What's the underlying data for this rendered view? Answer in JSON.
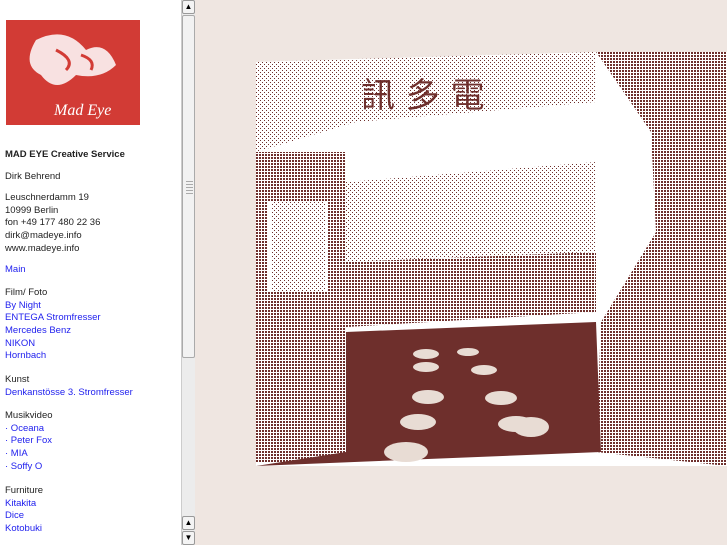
{
  "logo": {
    "text": "Mad Eye",
    "color": "#d23b35"
  },
  "sidebar": {
    "company": "MAD EYE Creative Service",
    "name": "Dirk Behrend",
    "address": [
      "Leuschnerdamm 19",
      "10999 Berlin",
      "fon +49 177 480 22 36",
      "dirk@madeye.info",
      "www.madeye.info"
    ],
    "main_link": "Main",
    "sections": [
      {
        "title": "Film/ Foto",
        "links": [
          "By Night",
          "ENTEGA Stromfresser",
          "Mercedes Benz",
          "NIKON",
          "Hornbach"
        ]
      },
      {
        "title": "Kunst",
        "links": [
          "Denkanstösse 3. Stromfresser"
        ]
      },
      {
        "title": "Musikvideo",
        "links": [
          "· Oceana",
          "· Peter Fox",
          "· MIA",
          "· Soffy O"
        ]
      },
      {
        "title": "Furniture",
        "links": [
          "Kitakita",
          "Dice",
          "Kotobuki"
        ]
      }
    ]
  },
  "scrollbar": {
    "up": "▲",
    "down": "▼",
    "position": 0
  },
  "photo": {
    "sign": "訊 多 電",
    "color": "#6e2f2c"
  }
}
